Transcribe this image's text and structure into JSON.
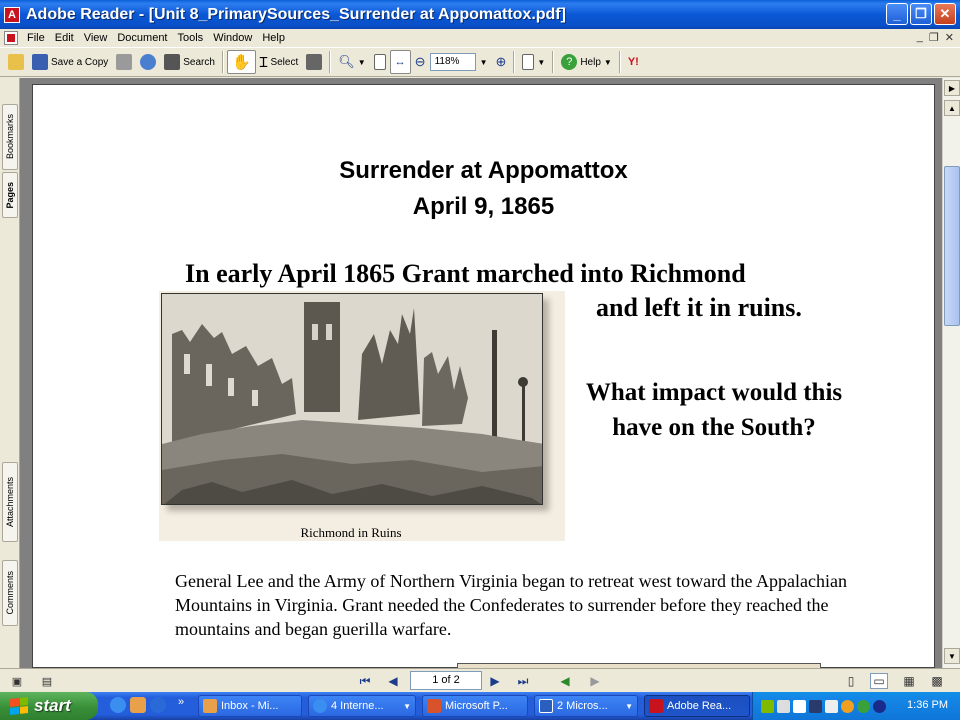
{
  "window": {
    "title": "Adobe Reader - [Unit 8_PrimarySources_Surrender at Appomattox.pdf]",
    "app_icon_letter": "A"
  },
  "menu": {
    "items": [
      "File",
      "Edit",
      "View",
      "Document",
      "Tools",
      "Window",
      "Help"
    ]
  },
  "toolbar": {
    "save_copy_label": "Save a Copy",
    "search_label": "Search",
    "select_label": "Select",
    "zoom_value": "118%",
    "help_label": "Help"
  },
  "navtabs": [
    "Bookmarks",
    "Pages",
    "Attachments",
    "Comments"
  ],
  "document": {
    "title": "Surrender at Appomattox",
    "date": "April 9, 1865",
    "line1": "In early April 1865 Grant marched into Richmond",
    "line2": "and left it in ruins.",
    "question": "What impact would this have on the South?",
    "caption": "Richmond in Ruins",
    "body": "General Lee and the Army of Northern Virginia began to retreat west toward the Appalachian Mountains in Virginia.  Grant needed the Confederates to surrender before they reached the mountains and began guerilla warfare."
  },
  "statusbar": {
    "page_indicator": "1 of 2"
  },
  "taskbar": {
    "start_label": "start",
    "tasks": [
      {
        "label": "Inbox - Mi...",
        "color": "#e8a04a"
      },
      {
        "label": "4 Interne...",
        "color": "#3a8ef0"
      },
      {
        "label": "Microsoft P...",
        "color": "#d8532c"
      },
      {
        "label": "2 Micros...",
        "color": "#2b5fbf"
      },
      {
        "label": "Adobe Rea...",
        "color": "#c8121e"
      }
    ],
    "clock": "1:36 PM"
  }
}
